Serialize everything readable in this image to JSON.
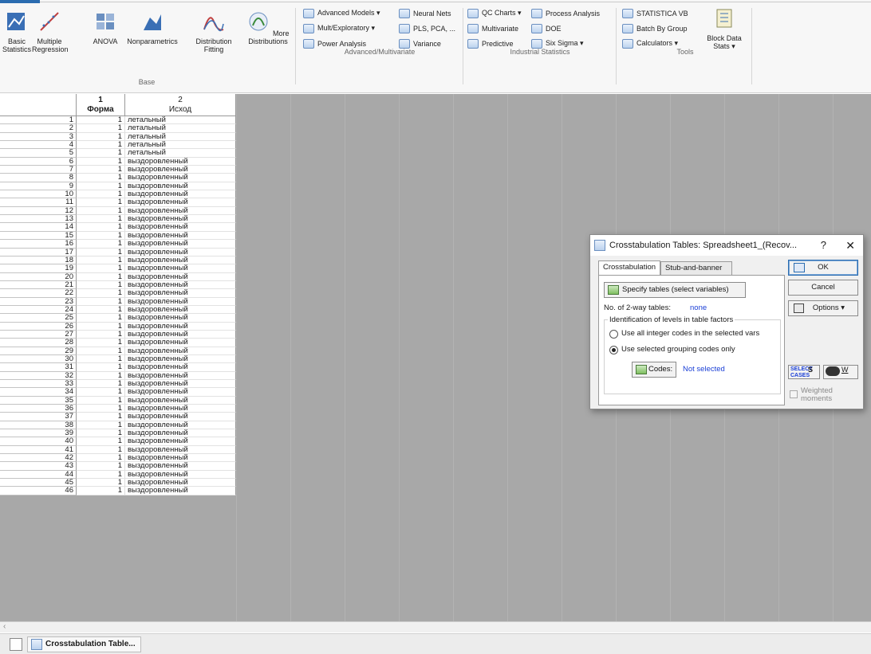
{
  "ribbon": {
    "groups": [
      {
        "label": "Base",
        "buttons": [
          "Basic Statistics",
          "Multiple Regression",
          "ANOVA",
          "Nonparametrics",
          "Distribution Fitting",
          "More Distributions"
        ]
      },
      {
        "label": "Advanced/Multivariate",
        "items": [
          "Advanced Models ▾",
          "Neural Nets",
          "Mult/Exploratory ▾",
          "PLS, PCA, ...",
          "Power Analysis",
          "Variance"
        ]
      },
      {
        "label": "Industrial Statistics",
        "items": [
          "QC Charts ▾",
          "Process Analysis",
          "Multivariate",
          "DOE",
          "Predictive",
          "Six Sigma ▾"
        ]
      },
      {
        "label": "Tools",
        "items": [
          "STATISTICA VB",
          "Batch By Group",
          "Calculators ▾"
        ],
        "big": "Block Data Stats ▾"
      }
    ]
  },
  "sheet": {
    "columns": [
      {
        "num": "1",
        "name": "Форма"
      },
      {
        "num": "2",
        "name": "Исход"
      }
    ],
    "rows": [
      [
        "1",
        "1",
        "летальный"
      ],
      [
        "2",
        "1",
        "летальный"
      ],
      [
        "3",
        "1",
        "летальный"
      ],
      [
        "4",
        "1",
        "летальный"
      ],
      [
        "5",
        "1",
        "летальный"
      ],
      [
        "6",
        "1",
        "выздоровленный"
      ],
      [
        "7",
        "1",
        "выздоровленный"
      ],
      [
        "8",
        "1",
        "выздоровленный"
      ],
      [
        "9",
        "1",
        "выздоровленный"
      ],
      [
        "10",
        "1",
        "выздоровленный"
      ],
      [
        "11",
        "1",
        "выздоровленный"
      ],
      [
        "12",
        "1",
        "выздоровленный"
      ],
      [
        "13",
        "1",
        "выздоровленный"
      ],
      [
        "14",
        "1",
        "выздоровленный"
      ],
      [
        "15",
        "1",
        "выздоровленный"
      ],
      [
        "16",
        "1",
        "выздоровленный"
      ],
      [
        "17",
        "1",
        "выздоровленный"
      ],
      [
        "18",
        "1",
        "выздоровленный"
      ],
      [
        "19",
        "1",
        "выздоровленный"
      ],
      [
        "20",
        "1",
        "выздоровленный"
      ],
      [
        "21",
        "1",
        "выздоровленный"
      ],
      [
        "22",
        "1",
        "выздоровленный"
      ],
      [
        "23",
        "1",
        "выздоровленный"
      ],
      [
        "24",
        "1",
        "выздоровленный"
      ],
      [
        "25",
        "1",
        "выздоровленный"
      ],
      [
        "26",
        "1",
        "выздоровленный"
      ],
      [
        "27",
        "1",
        "выздоровленный"
      ],
      [
        "28",
        "1",
        "выздоровленный"
      ],
      [
        "29",
        "1",
        "выздоровленный"
      ],
      [
        "30",
        "1",
        "выздоровленный"
      ],
      [
        "31",
        "1",
        "выздоровленный"
      ],
      [
        "32",
        "1",
        "выздоровленный"
      ],
      [
        "33",
        "1",
        "выздоровленный"
      ],
      [
        "34",
        "1",
        "выздоровленный"
      ],
      [
        "35",
        "1",
        "выздоровленный"
      ],
      [
        "36",
        "1",
        "выздоровленный"
      ],
      [
        "37",
        "1",
        "выздоровленный"
      ],
      [
        "38",
        "1",
        "выздоровленный"
      ],
      [
        "39",
        "1",
        "выздоровленный"
      ],
      [
        "40",
        "1",
        "выздоровленный"
      ],
      [
        "41",
        "1",
        "выздоровленный"
      ],
      [
        "42",
        "1",
        "выздоровленный"
      ],
      [
        "43",
        "1",
        "выздоровленный"
      ],
      [
        "44",
        "1",
        "выздоровленный"
      ],
      [
        "45",
        "1",
        "выздоровленный"
      ],
      [
        "46",
        "1",
        "выздоровленный"
      ]
    ]
  },
  "taskbar": {
    "item_label": "Crosstabulation Table..."
  },
  "dialog": {
    "title": "Crosstabulation Tables: Spreadsheet1_(Recov...",
    "help": "?",
    "close": "✕",
    "tabs": [
      "Crosstabulation",
      "Stub-and-banner"
    ],
    "specify_button": "Specify tables (select variables)",
    "num_tables_label": "No. of 2-way tables:",
    "num_tables_value": "none",
    "group_label": "Identification of levels in table factors",
    "radio1": "Use all integer codes in the selected vars",
    "radio2": "Use selected grouping codes only",
    "codes_button": "Codes:",
    "codes_value": "Not selected",
    "ok": "OK",
    "cancel": "Cancel",
    "options": "Options ▾",
    "select_cases": "SELECT CASES",
    "s_label": "S",
    "w_label": "W",
    "weighted": "Weighted moments"
  }
}
